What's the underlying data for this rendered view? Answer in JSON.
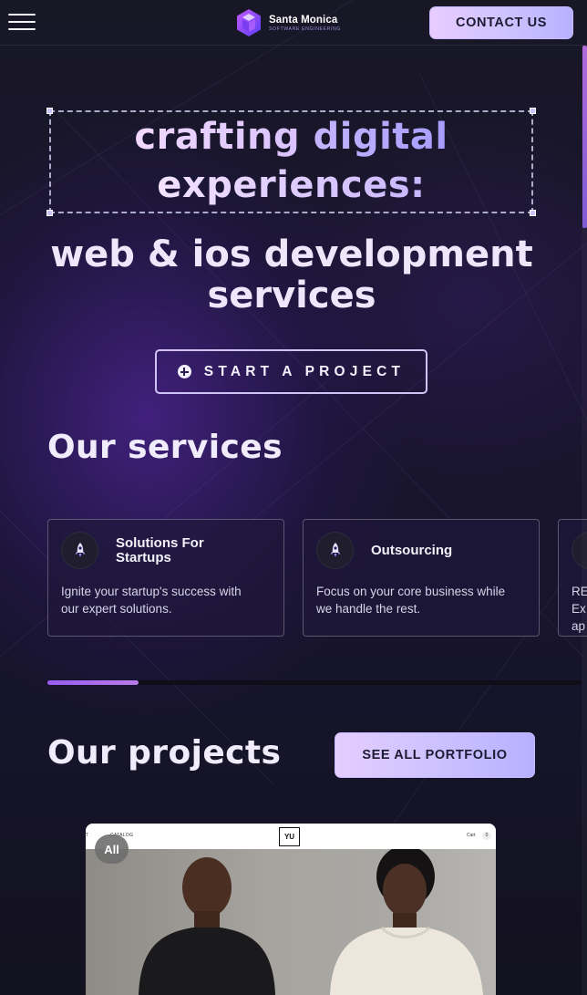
{
  "header": {
    "brand_name": "Santa Monica",
    "brand_tagline": "SOFTWARE ENGINEERING",
    "contact_label": "CONTACT US"
  },
  "hero": {
    "title_word1": "crafting",
    "title_word2": "digital",
    "title_word3": "experiences:",
    "subtitle_line1": "web & ios development",
    "subtitle_line2": "services",
    "cta_label": "START A PROJECT"
  },
  "services": {
    "heading": "Our services",
    "cards": [
      {
        "icon": "rocket-icon",
        "title_line1": "Solutions For",
        "title_line2": "Startups",
        "desc_line1": "Ignite your startup's success with",
        "desc_line2": "our expert solutions."
      },
      {
        "icon": "rocket-icon",
        "title": "Outsourcing",
        "desc_line1": "Focus on your core business while",
        "desc_line2": "we handle the rest."
      },
      {
        "icon": "rocket-icon",
        "desc_line1": "RE",
        "desc_line2": "Ex",
        "desc_line3": "ap"
      }
    ],
    "carousel_progress": 0.17
  },
  "projects": {
    "heading": "Our projects",
    "portfolio_label": "SEE ALL PORTFOLIO",
    "filter_badge": "All",
    "preview": {
      "nav_left": "T",
      "nav_catalog": "CATALOG",
      "logo": "YU",
      "cart_label": "Cart",
      "cart_count": "0"
    }
  },
  "colors": {
    "background": "#13121f",
    "accent_gradient_start": "#e8ccff",
    "accent_gradient_end": "#b8b1ff",
    "progress_accent": "#9a5cf0"
  }
}
